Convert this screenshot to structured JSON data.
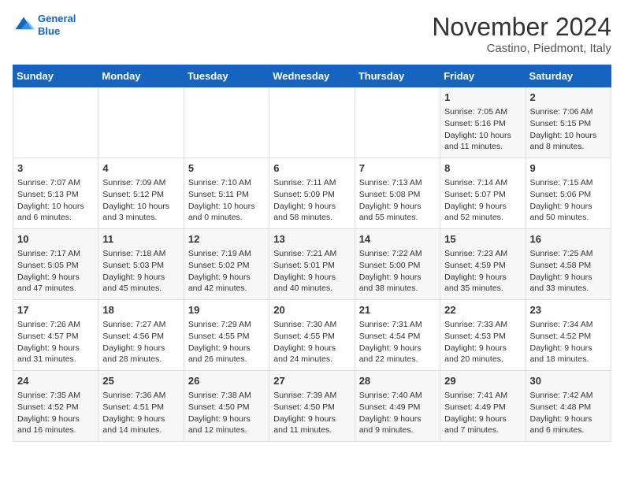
{
  "header": {
    "logo_line1": "General",
    "logo_line2": "Blue",
    "month": "November 2024",
    "location": "Castino, Piedmont, Italy"
  },
  "days_of_week": [
    "Sunday",
    "Monday",
    "Tuesday",
    "Wednesday",
    "Thursday",
    "Friday",
    "Saturday"
  ],
  "weeks": [
    [
      {
        "day": "",
        "info": ""
      },
      {
        "day": "",
        "info": ""
      },
      {
        "day": "",
        "info": ""
      },
      {
        "day": "",
        "info": ""
      },
      {
        "day": "",
        "info": ""
      },
      {
        "day": "1",
        "info": "Sunrise: 7:05 AM\nSunset: 5:16 PM\nDaylight: 10 hours and 11 minutes."
      },
      {
        "day": "2",
        "info": "Sunrise: 7:06 AM\nSunset: 5:15 PM\nDaylight: 10 hours and 8 minutes."
      }
    ],
    [
      {
        "day": "3",
        "info": "Sunrise: 7:07 AM\nSunset: 5:13 PM\nDaylight: 10 hours and 6 minutes."
      },
      {
        "day": "4",
        "info": "Sunrise: 7:09 AM\nSunset: 5:12 PM\nDaylight: 10 hours and 3 minutes."
      },
      {
        "day": "5",
        "info": "Sunrise: 7:10 AM\nSunset: 5:11 PM\nDaylight: 10 hours and 0 minutes."
      },
      {
        "day": "6",
        "info": "Sunrise: 7:11 AM\nSunset: 5:09 PM\nDaylight: 9 hours and 58 minutes."
      },
      {
        "day": "7",
        "info": "Sunrise: 7:13 AM\nSunset: 5:08 PM\nDaylight: 9 hours and 55 minutes."
      },
      {
        "day": "8",
        "info": "Sunrise: 7:14 AM\nSunset: 5:07 PM\nDaylight: 9 hours and 52 minutes."
      },
      {
        "day": "9",
        "info": "Sunrise: 7:15 AM\nSunset: 5:06 PM\nDaylight: 9 hours and 50 minutes."
      }
    ],
    [
      {
        "day": "10",
        "info": "Sunrise: 7:17 AM\nSunset: 5:05 PM\nDaylight: 9 hours and 47 minutes."
      },
      {
        "day": "11",
        "info": "Sunrise: 7:18 AM\nSunset: 5:03 PM\nDaylight: 9 hours and 45 minutes."
      },
      {
        "day": "12",
        "info": "Sunrise: 7:19 AM\nSunset: 5:02 PM\nDaylight: 9 hours and 42 minutes."
      },
      {
        "day": "13",
        "info": "Sunrise: 7:21 AM\nSunset: 5:01 PM\nDaylight: 9 hours and 40 minutes."
      },
      {
        "day": "14",
        "info": "Sunrise: 7:22 AM\nSunset: 5:00 PM\nDaylight: 9 hours and 38 minutes."
      },
      {
        "day": "15",
        "info": "Sunrise: 7:23 AM\nSunset: 4:59 PM\nDaylight: 9 hours and 35 minutes."
      },
      {
        "day": "16",
        "info": "Sunrise: 7:25 AM\nSunset: 4:58 PM\nDaylight: 9 hours and 33 minutes."
      }
    ],
    [
      {
        "day": "17",
        "info": "Sunrise: 7:26 AM\nSunset: 4:57 PM\nDaylight: 9 hours and 31 minutes."
      },
      {
        "day": "18",
        "info": "Sunrise: 7:27 AM\nSunset: 4:56 PM\nDaylight: 9 hours and 28 minutes."
      },
      {
        "day": "19",
        "info": "Sunrise: 7:29 AM\nSunset: 4:55 PM\nDaylight: 9 hours and 26 minutes."
      },
      {
        "day": "20",
        "info": "Sunrise: 7:30 AM\nSunset: 4:55 PM\nDaylight: 9 hours and 24 minutes."
      },
      {
        "day": "21",
        "info": "Sunrise: 7:31 AM\nSunset: 4:54 PM\nDaylight: 9 hours and 22 minutes."
      },
      {
        "day": "22",
        "info": "Sunrise: 7:33 AM\nSunset: 4:53 PM\nDaylight: 9 hours and 20 minutes."
      },
      {
        "day": "23",
        "info": "Sunrise: 7:34 AM\nSunset: 4:52 PM\nDaylight: 9 hours and 18 minutes."
      }
    ],
    [
      {
        "day": "24",
        "info": "Sunrise: 7:35 AM\nSunset: 4:52 PM\nDaylight: 9 hours and 16 minutes."
      },
      {
        "day": "25",
        "info": "Sunrise: 7:36 AM\nSunset: 4:51 PM\nDaylight: 9 hours and 14 minutes."
      },
      {
        "day": "26",
        "info": "Sunrise: 7:38 AM\nSunset: 4:50 PM\nDaylight: 9 hours and 12 minutes."
      },
      {
        "day": "27",
        "info": "Sunrise: 7:39 AM\nSunset: 4:50 PM\nDaylight: 9 hours and 11 minutes."
      },
      {
        "day": "28",
        "info": "Sunrise: 7:40 AM\nSunset: 4:49 PM\nDaylight: 9 hours and 9 minutes."
      },
      {
        "day": "29",
        "info": "Sunrise: 7:41 AM\nSunset: 4:49 PM\nDaylight: 9 hours and 7 minutes."
      },
      {
        "day": "30",
        "info": "Sunrise: 7:42 AM\nSunset: 4:48 PM\nDaylight: 9 hours and 6 minutes."
      }
    ]
  ]
}
